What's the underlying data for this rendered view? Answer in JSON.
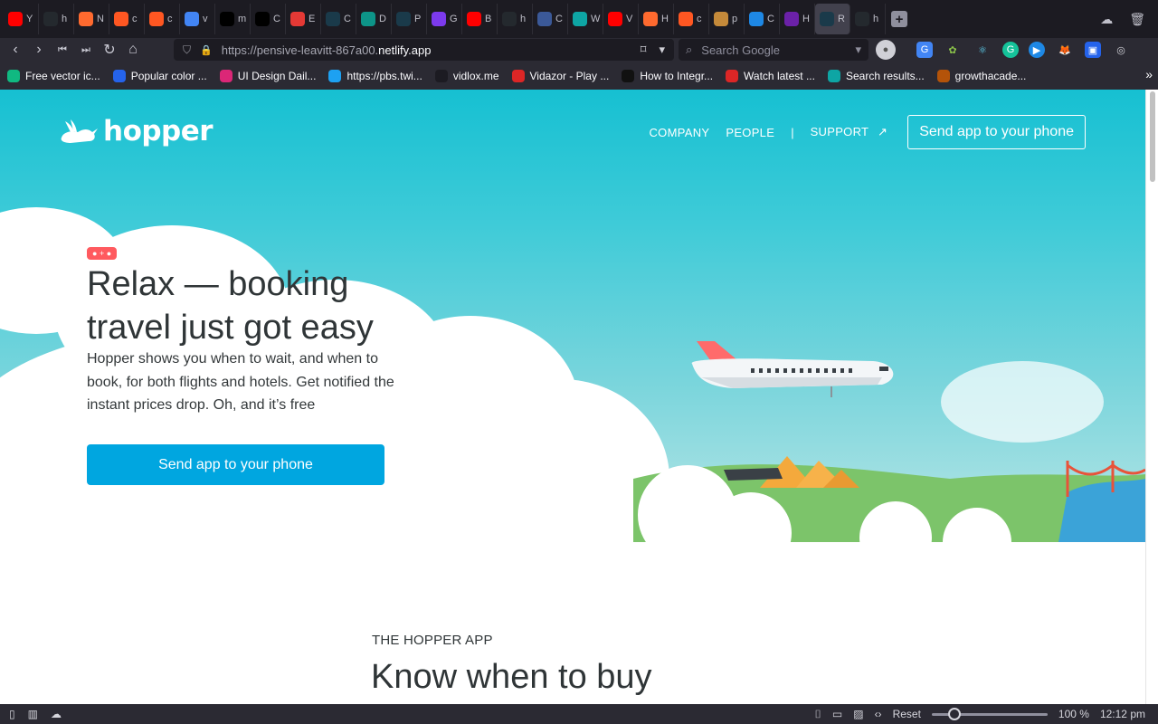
{
  "browser": {
    "tabs": [
      {
        "letter": "Y",
        "color": "#ff0000",
        "icon": "youtube-icon"
      },
      {
        "letter": "h",
        "color": "#24292e",
        "icon": "github-icon"
      },
      {
        "letter": "N",
        "color": "#ff6a2f",
        "icon": "chart-icon"
      },
      {
        "letter": "c",
        "color": "#ff5722",
        "icon": "link-icon"
      },
      {
        "letter": "c",
        "color": "#ff5722",
        "icon": "link-icon"
      },
      {
        "letter": "v",
        "color": "#4285f4",
        "icon": "google-icon"
      },
      {
        "letter": "m",
        "color": "#000000",
        "icon": "triangle-icon"
      },
      {
        "letter": "C",
        "color": "#000000",
        "icon": "triangle-icon"
      },
      {
        "letter": "E",
        "color": "#e53935",
        "icon": "pinterest-icon"
      },
      {
        "letter": "C",
        "color": "#1a3a4a",
        "icon": "react-icon"
      },
      {
        "letter": "D",
        "color": "#0d9488",
        "icon": "diamond-icon"
      },
      {
        "letter": "P",
        "color": "#1a3a4a",
        "icon": "react-icon"
      },
      {
        "letter": "G",
        "color": "#7c3aed",
        "icon": "shield-icon"
      },
      {
        "letter": "B",
        "color": "#ff0000",
        "icon": "youtube-icon"
      },
      {
        "letter": "h",
        "color": "#24292e",
        "icon": "github-icon"
      },
      {
        "letter": "C",
        "color": "#3b5998",
        "icon": "ghost-icon"
      },
      {
        "letter": "W",
        "color": "#0ea5a4",
        "icon": "s-icon"
      },
      {
        "letter": "V",
        "color": "#ff0000",
        "icon": "youtube-icon"
      },
      {
        "letter": "H",
        "color": "#ff6a2f",
        "icon": "chart-icon"
      },
      {
        "letter": "c",
        "color": "#ff5722",
        "icon": "link-icon"
      },
      {
        "letter": "p",
        "color": "#c58a3a",
        "icon": "mountain-icon"
      },
      {
        "letter": "C",
        "color": "#1e88e5",
        "icon": "bars-icon"
      },
      {
        "letter": "H",
        "color": "#6b21a8",
        "icon": "ta-icon"
      },
      {
        "letter": "R",
        "color": "#1a3a4a",
        "icon": "react-icon"
      },
      {
        "letter": "h",
        "color": "#24292e",
        "icon": "github-icon"
      }
    ],
    "active_tab_index": 23,
    "url_prefix": "https://pensive-leavitt-867a00.",
    "url_domain": "netlify.app",
    "search_placeholder": "Search Google",
    "bookmarks": [
      {
        "label": "Free vector ic...",
        "color": "#10b981",
        "icon": "bookmark-freepik-icon"
      },
      {
        "label": "Popular color ...",
        "color": "#2563eb",
        "icon": "bookmark-color-icon"
      },
      {
        "label": "UI Design Dail...",
        "color": "#db2777",
        "icon": "bookmark-ui-icon"
      },
      {
        "label": "https://pbs.twi...",
        "color": "#1da1f2",
        "icon": "twitter-icon"
      },
      {
        "label": "vidlox.me",
        "color": "#1c1b22",
        "icon": "play-icon"
      },
      {
        "label": "Vidazor - Play ...",
        "color": "#dc2626",
        "icon": "v-icon"
      },
      {
        "label": "How to Integr...",
        "color": "#111111",
        "icon": "c-icon"
      },
      {
        "label": "Watch latest ...",
        "color": "#dc2626",
        "icon": "m-icon"
      },
      {
        "label": "Search results...",
        "color": "#0ea5a4",
        "icon": "s-icon"
      },
      {
        "label": "growthacade...",
        "color": "#b45309",
        "icon": "growth-icon"
      }
    ]
  },
  "page": {
    "logo_text": "hopper",
    "nav": {
      "company": "COMPANY",
      "people": "PEOPLE",
      "separator": "|",
      "support": "SUPPORT",
      "cta": "Send app to your phone"
    },
    "hero": {
      "badge": "• + •",
      "headline": "Relax — booking travel just got easy",
      "subtext": "Hopper shows you when to wait, and when to book, for both flights and hotels. Get notified the instant prices drop. Oh, and it’s free",
      "cta": "Send app to your phone"
    },
    "section": {
      "eyebrow": "THE HOPPER APP",
      "title": "Know when to buy"
    }
  },
  "statusbar": {
    "reset": "Reset",
    "zoom": "100 %",
    "time": "12:12 pm",
    "zoom_level": 0.16
  },
  "colors": {
    "brand_teal": "#16c0d2",
    "cta_blue": "#00a6e0",
    "badge_red": "#ff5a5f",
    "text_dark": "#2f3537"
  }
}
